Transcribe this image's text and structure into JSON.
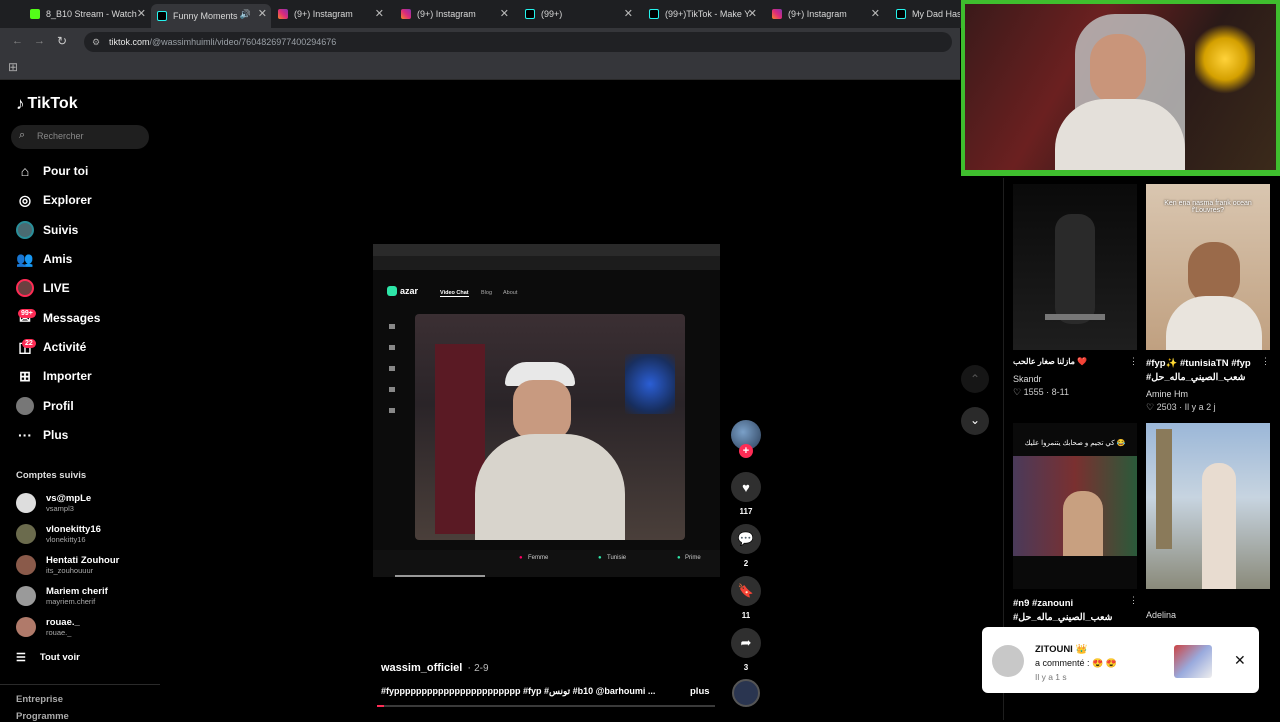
{
  "browser": {
    "tabs": [
      {
        "title": "8_B10 Stream - Watch"
      },
      {
        "title": "Funny Moments"
      },
      {
        "title": "(9+) Instagram"
      },
      {
        "title": "(9+) Instagram"
      },
      {
        "title": "(99+)"
      },
      {
        "title": "(99+)TikTok - Make Y"
      },
      {
        "title": "(9+) Instagram"
      },
      {
        "title": "My Dad Has a"
      }
    ],
    "url_host": "tiktok.com",
    "url_path": "/@wassimhuimli/video/7604826977400294676"
  },
  "sidebar": {
    "logo": "TikTok",
    "search_placeholder": "Rechercher",
    "nav": [
      {
        "label": "Pour toi",
        "icon": "home-icon"
      },
      {
        "label": "Explorer",
        "icon": "compass-icon"
      },
      {
        "label": "Suivis",
        "icon": "following-avatar-icon"
      },
      {
        "label": "Amis",
        "icon": "friends-icon"
      },
      {
        "label": "LIVE",
        "icon": "live-icon"
      },
      {
        "label": "Messages",
        "icon": "messages-icon",
        "badge": "99+"
      },
      {
        "label": "Activité",
        "icon": "activity-icon",
        "badge": "22"
      },
      {
        "label": "Importer",
        "icon": "upload-icon"
      },
      {
        "label": "Profil",
        "icon": "profile-icon"
      },
      {
        "label": "Plus",
        "icon": "more-icon"
      }
    ],
    "following_title": "Comptes suivis",
    "following": [
      {
        "name": "vs@mpLe",
        "handle": "vsampl3"
      },
      {
        "name": "vlonekitty16",
        "handle": "vlonekitty16"
      },
      {
        "name": "Hentati Zouhour",
        "handle": "its_zouhouuur"
      },
      {
        "name": "Mariem cherif",
        "handle": "mayriem.cherif"
      },
      {
        "name": "rouae._",
        "handle": "rouae._"
      }
    ],
    "see_all": "Tout voir",
    "footer_1": "Entreprise",
    "footer_2": "Programme"
  },
  "video": {
    "inner": {
      "brand": "azar",
      "menu_1": "Video Chat",
      "menu_2": "Blog",
      "menu_3": "About",
      "filter_1": "Femme",
      "filter_2": "Tunisie",
      "filter_3": "Prime"
    },
    "author": "wassim_officiel",
    "date": "2-9",
    "caption": "#fyppppppppppppppppppppppp #fyp #تونس #b10 @barhoumi ...",
    "more": "plus",
    "progress": 0.02
  },
  "actions": {
    "likes": "117",
    "comments": "2",
    "saves": "11",
    "shares": "3"
  },
  "feed": [
    {
      "caption": "مازلنا صغار عالحب ❤️",
      "author": "Skandr",
      "likes": "1555",
      "age": "8-11",
      "overlay": ""
    },
    {
      "caption": "#fyp✨ #tunisiaTN #fyp #شعب_الصيني_ماله_حل😂...",
      "author": "Amine Hm",
      "likes": "2503",
      "age": "Il y a 2 j",
      "overlay": "Ken ena nasma frank ocean f'Louvres?"
    },
    {
      "caption": "#n9 #zanouni #شعب_الصيني_ماله_حل😂...",
      "author": "",
      "likes": "",
      "age": "",
      "overlay": "كي تجيم و صحابك يتنمروا عليك 😂"
    },
    {
      "caption": "",
      "author": "Adelina",
      "likes": "",
      "age": "",
      "overlay": ""
    }
  ],
  "notification": {
    "user": "ZITOUNI 👑",
    "text": "a commenté : 😍 😍",
    "time": "Il y a 1 s"
  },
  "colors": {
    "accent": "#fe2c55",
    "webcam_border": "#3fbe2e"
  }
}
